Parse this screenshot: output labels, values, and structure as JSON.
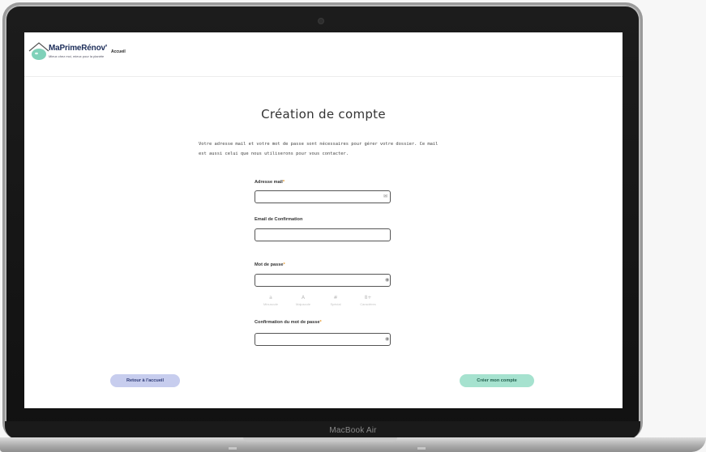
{
  "device": {
    "label": "MacBook Air"
  },
  "header": {
    "brand": "MaPrimeRénov'",
    "tagline": "Mieux chez moi, mieux pour la planète",
    "nav_home": "Accueil"
  },
  "page": {
    "title": "Création de compte",
    "intro": "Votre adresse mail et votre mot de passe sont nécessaires pour gérer votre dossier. Ce mail est aussi celui que nous utiliserons pour vous contacter."
  },
  "form": {
    "email": {
      "label": "Adresse mail",
      "required_mark": "*",
      "value": "",
      "icon": "envelope-icon"
    },
    "email_confirm": {
      "label": "Email de Confirmation",
      "value": ""
    },
    "password": {
      "label": "Mot de passe",
      "required_mark": "*",
      "value": "",
      "icon": "eye-icon"
    },
    "password_hints": [
      {
        "symbol": "a",
        "text": "Minuscule"
      },
      {
        "symbol": "A",
        "text": "Majuscule"
      },
      {
        "symbol": "#",
        "text": "Spécial"
      },
      {
        "symbol": "8+",
        "text": "Caractères"
      }
    ],
    "password_confirm": {
      "label": "Confirmation du mot de passe",
      "required_mark": "*",
      "value": "",
      "icon": "eye-icon"
    }
  },
  "actions": {
    "back": "Retour à l'accueil",
    "create": "Créer mon compte"
  },
  "colors": {
    "brand_navy": "#1e2f5b",
    "required": "#e89a2b",
    "back_button": "#c7cdee",
    "create_button": "#a6e2cf"
  }
}
